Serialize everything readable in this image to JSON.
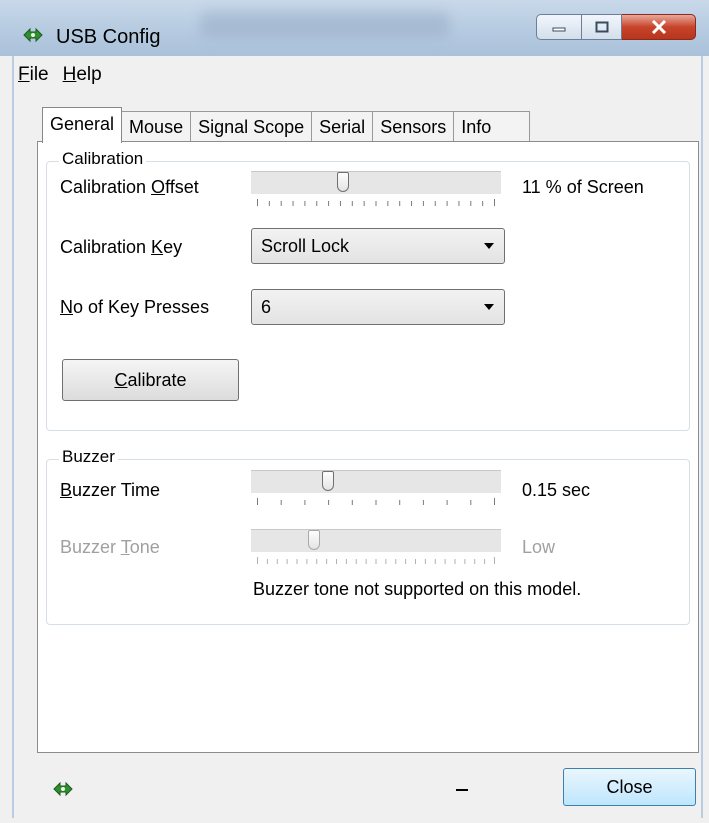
{
  "window": {
    "title": "USB Config",
    "icon": "usb-icon"
  },
  "menu": {
    "file": {
      "accel": "F",
      "rest": "ile"
    },
    "help": {
      "accel": "H",
      "rest": "elp"
    }
  },
  "tabs": [
    "General",
    "Mouse",
    "Signal Scope",
    "Serial",
    "Sensors",
    "Info"
  ],
  "active_tab": "General",
  "calibration": {
    "group_title": "Calibration",
    "offset_label": {
      "pre": "Calibration ",
      "accel": "O",
      "post": "ffset"
    },
    "offset_value": "11 % of Screen",
    "offset_fraction": 0.36,
    "key_label": {
      "pre": "Calibration ",
      "accel": "K",
      "post": "ey"
    },
    "key_value": "Scroll Lock",
    "presses_label": {
      "pre": "",
      "accel": "N",
      "post": "o of Key Presses"
    },
    "presses_value": "6",
    "calibrate_button": {
      "accel": "C",
      "rest": "alibrate"
    }
  },
  "buzzer": {
    "group_title": "Buzzer",
    "time_label": {
      "pre": "",
      "accel": "B",
      "post": "uzzer Time"
    },
    "time_value": "0.15 sec",
    "time_fraction": 0.3,
    "tone_label": {
      "pre": "Buzzer ",
      "accel": "T",
      "post": "one"
    },
    "tone_value": "Low",
    "tone_fraction": 0.24,
    "note": "Buzzer tone not supported on this model."
  },
  "footer": {
    "close_label": "Close",
    "status_icon": "usb-icon",
    "status_text": "_"
  }
}
